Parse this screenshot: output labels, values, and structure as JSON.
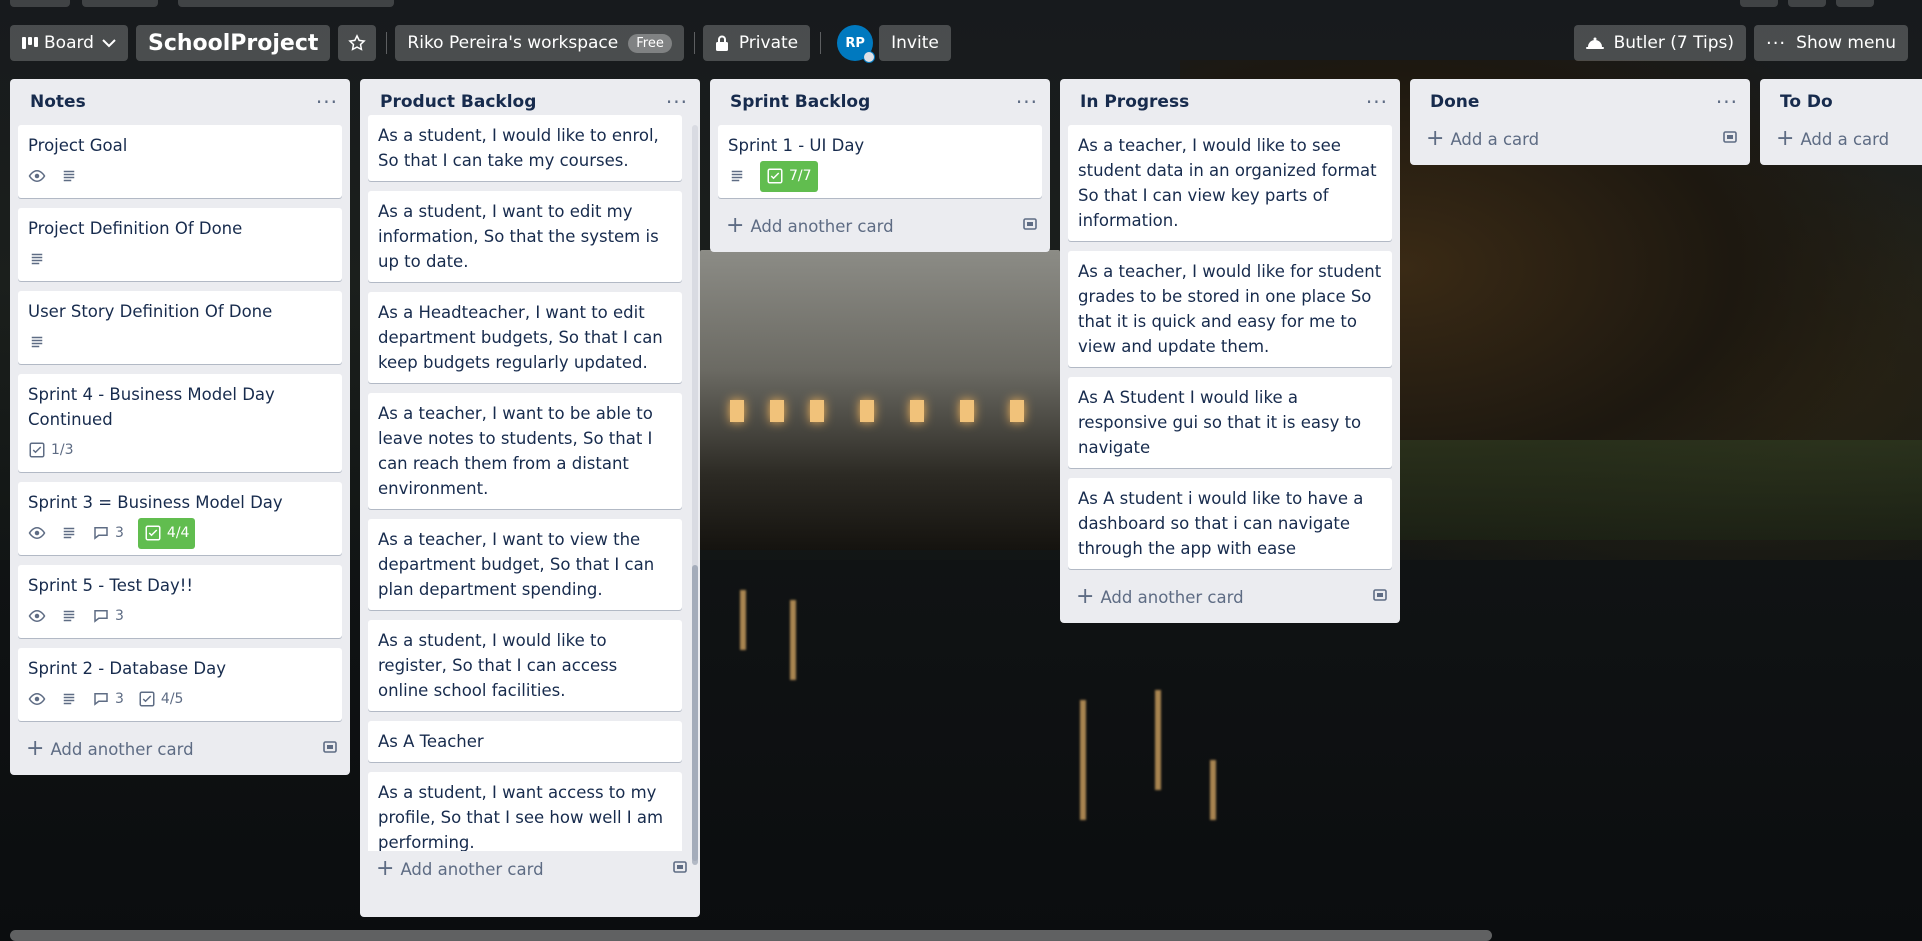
{
  "topbar": {
    "view_label": "Board",
    "board_title": "SchoolProject",
    "workspace_label": "Riko Pereira's workspace",
    "workspace_badge": "Free",
    "visibility_label": "Private",
    "avatar_initials": "RP",
    "invite_label": "Invite",
    "butler_label": "Butler (7 Tips)",
    "show_menu_label": "Show menu"
  },
  "lists": [
    {
      "title": "Notes",
      "add_label": "Add another card",
      "cards": [
        {
          "title": "Project Goal",
          "badges": {
            "watch": true,
            "description": true
          }
        },
        {
          "title": "Project Definition Of Done",
          "badges": {
            "description": true
          }
        },
        {
          "title": "User Story Definition Of Done",
          "badges": {
            "description": true
          }
        },
        {
          "title": "Sprint 4 - Business Model Day Continued",
          "badges": {
            "checklist": "1/3"
          }
        },
        {
          "title": "Sprint 3 = Business Model Day",
          "badges": {
            "watch": true,
            "description": true,
            "comments": "3",
            "checklist_complete": "4/4"
          }
        },
        {
          "title": "Sprint 5 - Test Day!!",
          "badges": {
            "watch": true,
            "description": true,
            "comments": "3"
          }
        },
        {
          "title": "Sprint 2 - Database Day",
          "badges": {
            "watch": true,
            "description": true,
            "comments": "3",
            "checklist": "4/5"
          }
        }
      ]
    },
    {
      "title": "Product Backlog",
      "add_label": "Add another card",
      "cards": [
        {
          "title": "As a student, I would like to enrol, So that I can take my courses."
        },
        {
          "title": "As a student, I want to edit my information, So that the system is up to date."
        },
        {
          "title": "As a Headteacher, I want to edit department budgets, So that I can keep budgets regularly updated."
        },
        {
          "title": "As a teacher, I want to be able to leave notes to students, So that I can reach them from a distant environment."
        },
        {
          "title": "As a teacher, I want to view the department budget, So that I can plan department spending."
        },
        {
          "title": "As a student, I would like to register, So that I can access online school facilities."
        },
        {
          "title": "As A Teacher"
        },
        {
          "title": "As a student, I want access to my profile, So that I see how well I am performing."
        }
      ]
    },
    {
      "title": "Sprint Backlog",
      "add_label": "Add another card",
      "cards": [
        {
          "title": "Sprint 1 - UI Day",
          "badges": {
            "description": true,
            "checklist_complete": "7/7"
          }
        }
      ]
    },
    {
      "title": "In Progress",
      "add_label": "Add another card",
      "cards": [
        {
          "title": "As a teacher, I would like to see student data in an organized format So that I can view key parts of information."
        },
        {
          "title": "As a teacher, I would like for student grades to be stored in one place So that it is quick and easy for me to view and update them."
        },
        {
          "title": "As A Student I would like a responsive gui so that it is easy to navigate"
        },
        {
          "title": "As A student i would like to have a dashboard so that i can navigate through the app with ease"
        }
      ]
    },
    {
      "title": "Done",
      "add_label": "Add a card",
      "cards": []
    },
    {
      "title": "To Do",
      "add_label": "Add a card",
      "cards": []
    }
  ],
  "colors": {
    "list_bg": "#ebecf0",
    "green_badge": "#61bd4f",
    "avatar_bg": "#0079bf"
  }
}
